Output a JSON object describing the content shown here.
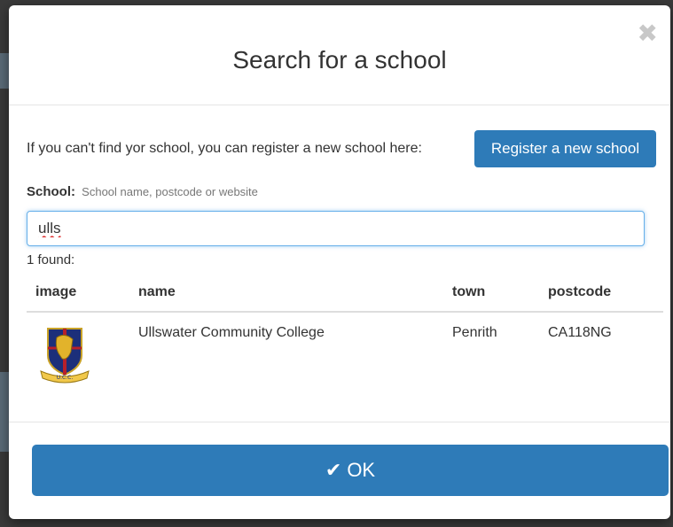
{
  "modal": {
    "title": "Search for a school",
    "close_glyph": "✖"
  },
  "register": {
    "prompt": "If you can't find yor school, you can register a new school here:",
    "button_label": "Register a new school"
  },
  "school_field": {
    "label": "School:",
    "hint": "School name, postcode or website",
    "value": "ulls"
  },
  "results": {
    "count_text": "1 found:",
    "columns": [
      "image",
      "name",
      "town",
      "postcode"
    ],
    "rows": [
      {
        "name": "Ullswater Community College",
        "town": "Penrith",
        "postcode": "CA118NG",
        "image_icon": "school-crest-icon"
      }
    ]
  },
  "footer": {
    "ok_label": "OK",
    "ok_icon": "check-icon"
  },
  "colors": {
    "primary": "#2e7bb8",
    "focus_border": "#66afe9"
  }
}
